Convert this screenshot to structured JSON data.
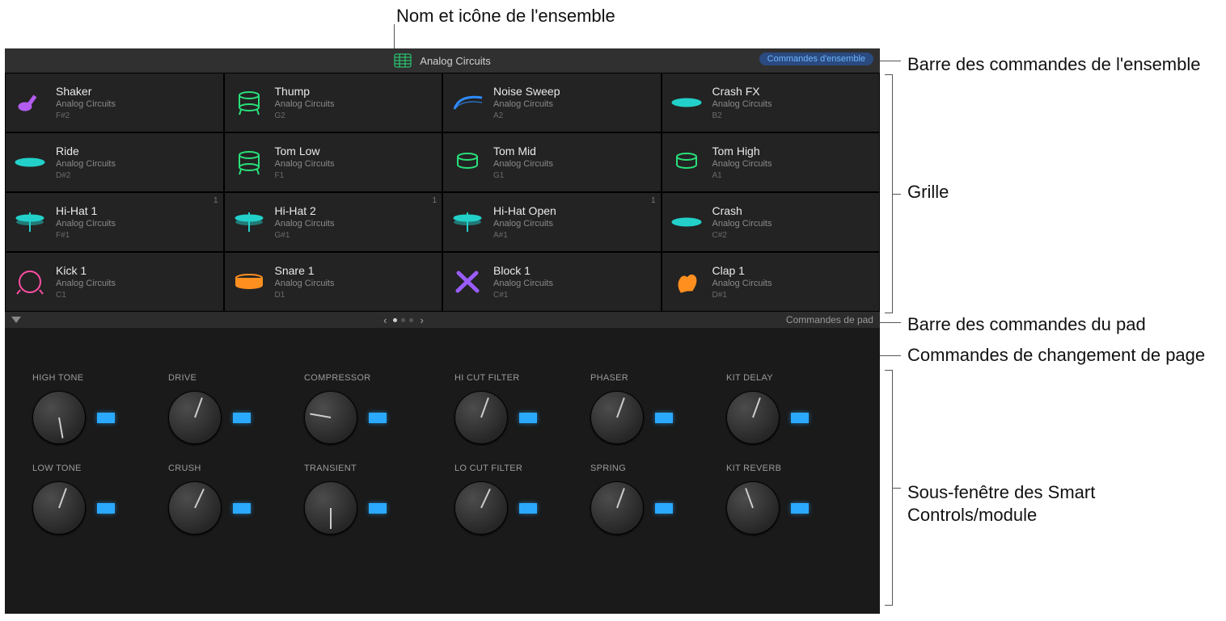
{
  "callouts": {
    "kit_name": "Nom et icône de l'ensemble",
    "kit_controls_bar": "Barre des commandes de l'ensemble",
    "grid": "Grille",
    "pad_bar": "Barre des commandes du pad",
    "page_change": "Commandes de changement de page",
    "smart_controls": "Sous-fenêtre des Smart Controls/module"
  },
  "header": {
    "title": "Analog Circuits",
    "button": "Commandes d'ensemble"
  },
  "grid": [
    [
      {
        "name": "Shaker",
        "sub": "Analog Circuits",
        "note": "F#2",
        "icon": "shaker",
        "color": "#b35df0"
      },
      {
        "name": "Thump",
        "sub": "Analog Circuits",
        "note": "G2",
        "icon": "floor-tom",
        "color": "#28e07a"
      },
      {
        "name": "Noise Sweep",
        "sub": "Analog Circuits",
        "note": "A2",
        "icon": "sweep",
        "color": "#2e8bff"
      },
      {
        "name": "Crash FX",
        "sub": "Analog Circuits",
        "note": "B2",
        "icon": "cymbal-flat",
        "color": "#22d0c9"
      }
    ],
    [
      {
        "name": "Ride",
        "sub": "Analog Circuits",
        "note": "D#2",
        "icon": "cymbal-flat",
        "color": "#22d0c9"
      },
      {
        "name": "Tom Low",
        "sub": "Analog Circuits",
        "note": "F1",
        "icon": "floor-tom",
        "color": "#28e07a"
      },
      {
        "name": "Tom Mid",
        "sub": "Analog Circuits",
        "note": "G1",
        "icon": "tom",
        "color": "#28e07a"
      },
      {
        "name": "Tom High",
        "sub": "Analog Circuits",
        "note": "A1",
        "icon": "tom",
        "color": "#28e07a"
      }
    ],
    [
      {
        "name": "Hi-Hat 1",
        "sub": "Analog Circuits",
        "note": "F#1",
        "icon": "hihat",
        "color": "#22d0c9",
        "link": "1"
      },
      {
        "name": "Hi-Hat 2",
        "sub": "Analog Circuits",
        "note": "G#1",
        "icon": "hihat",
        "color": "#22d0c9",
        "link": "1"
      },
      {
        "name": "Hi-Hat Open",
        "sub": "Analog Circuits",
        "note": "A#1",
        "icon": "hihat",
        "color": "#22d0c9",
        "link": "1"
      },
      {
        "name": "Crash",
        "sub": "Analog Circuits",
        "note": "C#2",
        "icon": "cymbal-flat",
        "color": "#22d0c9"
      }
    ],
    [
      {
        "name": "Kick 1",
        "sub": "Analog Circuits",
        "note": "C1",
        "icon": "kick",
        "color": "#ff4ea3"
      },
      {
        "name": "Snare 1",
        "sub": "Analog Circuits",
        "note": "D1",
        "icon": "snare",
        "color": "#ff8f1f"
      },
      {
        "name": "Block 1",
        "sub": "Analog Circuits",
        "note": "C#1",
        "icon": "sticks",
        "color": "#9a5cff"
      },
      {
        "name": "Clap 1",
        "sub": "Analog Circuits",
        "note": "D#1",
        "icon": "clap",
        "color": "#ff8f1f"
      }
    ]
  ],
  "padbar": {
    "right": "Commandes de pad"
  },
  "knob_panels": [
    [
      {
        "label": "HIGH TONE",
        "angle": -10
      },
      {
        "label": "DRIVE",
        "angle": 200
      },
      {
        "label": "COMPRESSOR",
        "angle": 100
      },
      {
        "label": "LOW TONE",
        "angle": 200
      },
      {
        "label": "CRUSH",
        "angle": 205
      },
      {
        "label": "TRANSIENT",
        "angle": 0
      }
    ],
    [
      {
        "label": "HI CUT FILTER",
        "angle": 200
      },
      {
        "label": "PHASER",
        "angle": 200
      },
      {
        "label": "KIT DELAY",
        "angle": 200
      },
      {
        "label": "LO CUT FILTER",
        "angle": 205
      },
      {
        "label": "SPRING",
        "angle": 200
      },
      {
        "label": "KIT REVERB",
        "angle": 160
      }
    ]
  ]
}
